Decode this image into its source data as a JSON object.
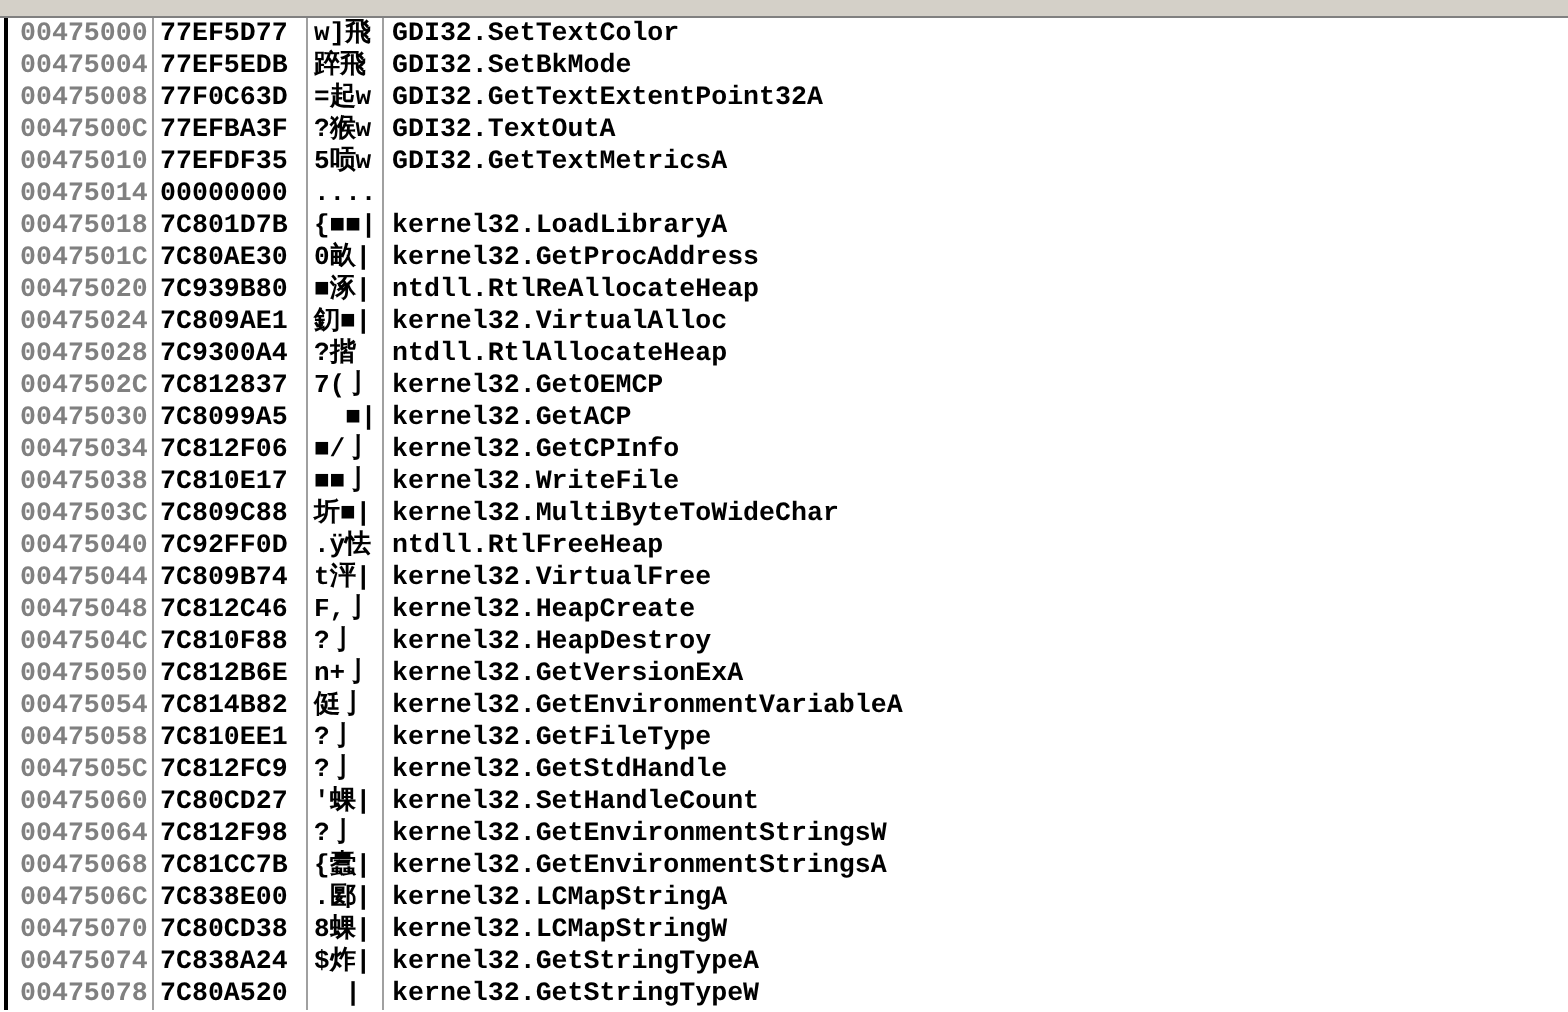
{
  "dump_rows": [
    {
      "address": "00475000",
      "hex": "77EF5D77",
      "ascii": "w]飛",
      "comment": "GDI32.SetTextColor"
    },
    {
      "address": "00475004",
      "hex": "77EF5EDB",
      "ascii": "踤飛",
      "comment": "GDI32.SetBkMode"
    },
    {
      "address": "00475008",
      "hex": "77F0C63D",
      "ascii": "=起w",
      "comment": "GDI32.GetTextExtentPoint32A"
    },
    {
      "address": "0047500C",
      "hex": "77EFBA3F",
      "ascii": "?猴w",
      "comment": "GDI32.TextOutA"
    },
    {
      "address": "00475010",
      "hex": "77EFDF35",
      "ascii": "5唝w",
      "comment": "GDI32.GetTextMetricsA"
    },
    {
      "address": "00475014",
      "hex": "00000000",
      "ascii": "...."
    },
    {
      "address": "00475018",
      "hex": "7C801D7B",
      "ascii": "{■■|",
      "comment": "kernel32.LoadLibraryA"
    },
    {
      "address": "0047501C",
      "hex": "7C80AE30",
      "ascii": "0畝|",
      "comment": "kernel32.GetProcAddress"
    },
    {
      "address": "00475020",
      "hex": "7C939B80",
      "ascii": "■涿|",
      "comment": "ntdll.RtlReAllocateHeap"
    },
    {
      "address": "00475024",
      "hex": "7C809AE1",
      "ascii": "釖■|",
      "comment": "kernel32.VirtualAlloc"
    },
    {
      "address": "00475028",
      "hex": "7C9300A4",
      "ascii": "?揩",
      "comment": "ntdll.RtlAllocateHeap"
    },
    {
      "address": "0047502C",
      "hex": "7C812837",
      "ascii": "7(亅",
      "comment": "kernel32.GetOEMCP"
    },
    {
      "address": "00475030",
      "hex": "7C8099A5",
      "ascii": "  ■|",
      "comment": "kernel32.GetACP"
    },
    {
      "address": "00475034",
      "hex": "7C812F06",
      "ascii": "■/亅",
      "comment": "kernel32.GetCPInfo"
    },
    {
      "address": "00475038",
      "hex": "7C810E17",
      "ascii": "■■亅",
      "comment": "kernel32.WriteFile"
    },
    {
      "address": "0047503C",
      "hex": "7C809C88",
      "ascii": "圻■|",
      "comment": "kernel32.MultiByteToWideChar"
    },
    {
      "address": "00475040",
      "hex": "7C92FF0D",
      "ascii": ".ÿ怯",
      "comment": "ntdll.RtlFreeHeap"
    },
    {
      "address": "00475044",
      "hex": "7C809B74",
      "ascii": "t泙|",
      "comment": "kernel32.VirtualFree"
    },
    {
      "address": "00475048",
      "hex": "7C812C46",
      "ascii": "F,亅",
      "comment": "kernel32.HeapCreate"
    },
    {
      "address": "0047504C",
      "hex": "7C810F88",
      "ascii": "?亅",
      "comment": "kernel32.HeapDestroy"
    },
    {
      "address": "00475050",
      "hex": "7C812B6E",
      "ascii": "n+亅",
      "comment": "kernel32.GetVersionExA"
    },
    {
      "address": "00475054",
      "hex": "7C814B82",
      "ascii": "侹亅",
      "comment": "kernel32.GetEnvironmentVariableA"
    },
    {
      "address": "00475058",
      "hex": "7C810EE1",
      "ascii": "?亅",
      "comment": "kernel32.GetFileType"
    },
    {
      "address": "0047505C",
      "hex": "7C812FC9",
      "ascii": "?亅",
      "comment": "kernel32.GetStdHandle"
    },
    {
      "address": "00475060",
      "hex": "7C80CD27",
      "ascii": "'蜾|",
      "comment": "kernel32.SetHandleCount"
    },
    {
      "address": "00475064",
      "hex": "7C812F98",
      "ascii": "?亅",
      "comment": "kernel32.GetEnvironmentStringsW"
    },
    {
      "address": "00475068",
      "hex": "7C81CC7B",
      "ascii": "{蠹|",
      "comment": "kernel32.GetEnvironmentStringsA"
    },
    {
      "address": "0047506C",
      "hex": "7C838E00",
      "ascii": ".郾|",
      "comment": "kernel32.LCMapStringA"
    },
    {
      "address": "00475070",
      "hex": "7C80CD38",
      "ascii": "8蜾|",
      "comment": "kernel32.LCMapStringW"
    },
    {
      "address": "00475074",
      "hex": "7C838A24",
      "ascii": "$炸|",
      "comment": "kernel32.GetStringTypeA"
    },
    {
      "address": "00475078",
      "hex": "7C80A520",
      "ascii": "  |",
      "comment": "kernel32.GetStringTypeW"
    }
  ]
}
